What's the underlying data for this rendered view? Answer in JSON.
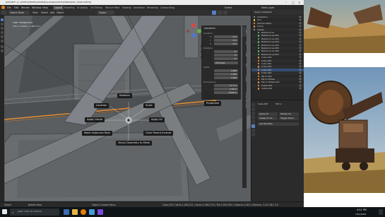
{
  "window": {
    "title": "Blender* [C:\\Users\\Reflet\\Desktop\\Cocoa\\Scene\\caterpillar_multi-blend]",
    "controls": [
      "–",
      "□",
      "✕"
    ]
  },
  "menu": {
    "items": [
      "File",
      "Edit",
      "Render",
      "Window",
      "Help"
    ],
    "workspaces": [
      "Layout",
      "Modeling",
      "Sculpting",
      "UV Editing",
      "Texture Paint",
      "Shading",
      "Animation",
      "Rendering",
      "Compositing"
    ],
    "active_workspace": "Layout",
    "scene": "Scene",
    "view_layer": "View Layer"
  },
  "header": {
    "mode": "Object Mode",
    "items": [
      "View",
      "Select",
      "Add",
      "Object"
    ],
    "transform": "Global"
  },
  "viewport": {
    "view_name": "User Perspective",
    "collection": "(962) Cables | Cube.023",
    "callouts": {
      "location": "Location",
      "rotation": "Rotation",
      "scale": "Scale",
      "apply_visual": "Apply Visual",
      "apply_all": "Apply All",
      "make_instances_real": "Make Instances Real",
      "clear_parent_inverse": "Clear Parent Inverse",
      "visual_geometry_to_mesh": "Visual Geometry to Mesh",
      "properties": "Properties",
      "transform": "Transform"
    }
  },
  "npanel": {
    "section": "Transform",
    "location_label": "Location:",
    "rotation_label": "Rotation:",
    "mode_value": "XYZ Euler",
    "scale_label": "Scale:",
    "dimensions_label": "Dimensions:",
    "axes": [
      "X",
      "Y",
      "Z"
    ],
    "location": [
      "0 m",
      "0 m",
      "0 m"
    ],
    "rotation": [
      "0°",
      "0°",
      "0°"
    ],
    "scale": [
      "1.000",
      "1.000",
      "1.000"
    ],
    "dimensions": [
      "17.7 m",
      "4.59 m",
      "4.804 m"
    ]
  },
  "ntabs": [
    "Item",
    "Tool",
    "View",
    "Edit",
    "Create",
    "Screencast Keys"
  ],
  "outliner": {
    "title": "Scene Collection",
    "rows": [
      {
        "name": "Collection",
        "color": "#8a8a8a"
      },
      {
        "name": "Sun",
        "color": "#e0c050"
      },
      {
        "name": "Vehicle Stairs",
        "color": "#e08a3a"
      },
      {
        "name": "Crane",
        "color": "#e08a3a"
      },
      {
        "name": "Cables",
        "color": "#8a8a8a"
      },
      {
        "name": "BezierCurve",
        "color": "#5fb05f"
      },
      {
        "name": "BezierCurve.001",
        "color": "#5fb05f"
      },
      {
        "name": "BezierCurve.002",
        "color": "#5fb05f"
      },
      {
        "name": "BezierCurve.003",
        "color": "#5fb05f"
      },
      {
        "name": "BezierCurve.004",
        "color": "#5fb05f"
      },
      {
        "name": "BezierCurve.005",
        "color": "#5fb05f"
      },
      {
        "name": "BezierCurve.006",
        "color": "#5fb05f"
      },
      {
        "name": "BezierCurve.007",
        "color": "#5fb05f"
      },
      {
        "name": "Cube.019",
        "color": "#e08a3a"
      },
      {
        "name": "Cube.020",
        "color": "#e08a3a"
      },
      {
        "name": "Cube.021",
        "color": "#e08a3a"
      },
      {
        "name": "Cube.022",
        "color": "#e08a3a"
      },
      {
        "name": "Cube.023",
        "color": "#e08a3a"
      },
      {
        "name": "Cube.024",
        "color": "#e08a3a"
      },
      {
        "name": "Mirror.001",
        "color": "#e08a3a"
      },
      {
        "name": "Mirror Wheel",
        "color": "#e08a3a"
      },
      {
        "name": "Mirror Wheel.001",
        "color": "#e08a3a"
      },
      {
        "name": "Cable.003",
        "color": "#e08a3a"
      },
      {
        "name": "Cable.004",
        "color": "#e08a3a"
      }
    ]
  },
  "properties": {
    "object": "Cube.023",
    "modifier": "Mirror",
    "apply_all": "Apply All",
    "delete_all": "Delete All",
    "viewport_vis": "Viewport Vis",
    "toggle_stack": "Toggle Stack",
    "add_modifier": "Add Modifier"
  },
  "statusbar": {
    "left": "Select",
    "middle": "Rotate View",
    "right": "Object Context Menu",
    "stats": "Cube.023 | Verts:1,280,211 | Faces:2,380,715 | Tris:2,592,004 | Objects:1/181 | Memory: 3.42 GiB | 3.0"
  },
  "taskbar": {
    "search_placeholder": "Type here to search",
    "time": "4:51 PM",
    "date": "7/21/2021"
  },
  "colors": {
    "accent": "#5680c2",
    "selection_orange": "#e89030",
    "viewport_bg": "#55595c"
  }
}
